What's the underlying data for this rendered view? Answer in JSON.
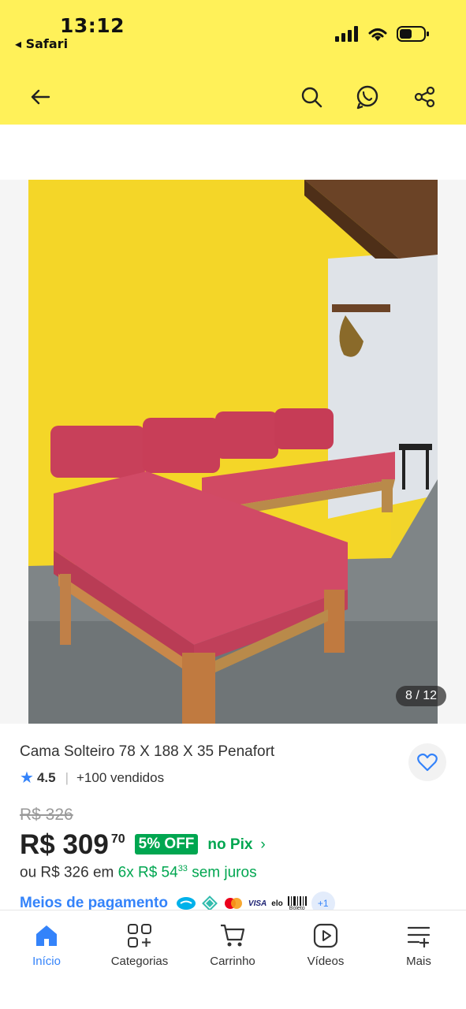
{
  "status_bar": {
    "time": "13:12",
    "back_app": "◂ Safari"
  },
  "header": {
    "icons": [
      "back-arrow-icon",
      "search-icon",
      "whatsapp-icon",
      "share-icon"
    ]
  },
  "gallery": {
    "counter": "8 / 12"
  },
  "product": {
    "title": "Cama Solteiro 78 X 188 X 35 Penafort",
    "rating": "4.5",
    "separator": "|",
    "sold": "+100 vendidos",
    "old_price": "R$ 326",
    "price_main": "R$ 309",
    "price_cents": "70",
    "discount": "5% OFF",
    "pix": "no Pix",
    "pix_chevron": "›",
    "installments_prefix": "ou R$ 326 em ",
    "installments_count": "6x R$ 54",
    "installments_cents": "33",
    "installments_suffix": " sem juros",
    "payment_link": "Meios de pagamento",
    "payment_more": "+1",
    "payment_labels": {
      "visa": "VISA",
      "elo": "elo",
      "boleto": "Boleto"
    }
  },
  "tabbar": {
    "tabs": [
      {
        "label": "Início",
        "icon": "home-icon",
        "active": true
      },
      {
        "label": "Categorias",
        "icon": "categories-icon",
        "active": false
      },
      {
        "label": "Carrinho",
        "icon": "cart-icon",
        "active": false
      },
      {
        "label": "Vídeos",
        "icon": "video-icon",
        "active": false
      },
      {
        "label": "Mais",
        "icon": "menu-icon",
        "active": false
      }
    ]
  },
  "colors": {
    "header_bg": "#fff159",
    "accent_blue": "#3483fa",
    "green": "#00a650"
  }
}
